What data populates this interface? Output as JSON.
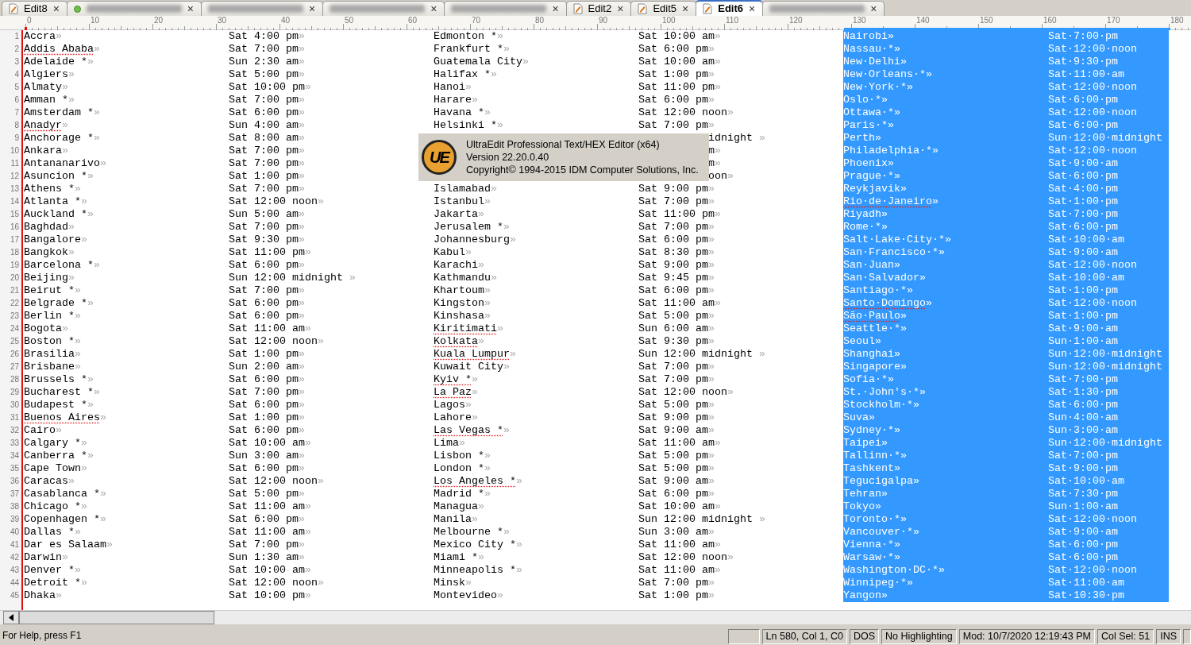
{
  "tabs": [
    {
      "kind": "document",
      "label": "Edit8",
      "close": "×",
      "selected": false
    },
    {
      "kind": "dot-blurred",
      "close": "×",
      "selected": false
    },
    {
      "kind": "blurred",
      "close": "×",
      "selected": false
    },
    {
      "kind": "blurred",
      "close": "×",
      "selected": false
    },
    {
      "kind": "blurred",
      "close": "×",
      "selected": false
    },
    {
      "kind": "document",
      "label": "Edit2",
      "close": "×",
      "selected": false
    },
    {
      "kind": "document",
      "label": "Edit5",
      "close": "×",
      "selected": false
    },
    {
      "kind": "document",
      "label": "Edit6",
      "close": "×",
      "selected": true
    },
    {
      "kind": "blurred",
      "close": "×",
      "selected": false
    }
  ],
  "ruler": [
    "0",
    "10",
    "20",
    "30",
    "40",
    "50",
    "60",
    "70",
    "80",
    "90",
    "100",
    "110",
    "120",
    "130",
    "140",
    "150",
    "160",
    "170",
    "180"
  ],
  "columns": [
    {
      "selected": false
    },
    {
      "selected": false
    },
    {
      "selected": false
    },
    {
      "selected": false
    },
    {
      "selected": true
    },
    {
      "selected": true
    }
  ],
  "lines": [
    {
      "n": "1",
      "cells": [
        "Accra»",
        "Sat 4:00 pm»",
        "Edmonton *»",
        "Sat 10:00 am»",
        "Nairobi»",
        "Sat·7:00·pm"
      ]
    },
    {
      "n": "2",
      "cells": [
        {
          "kind": "misspelled",
          "text": "Addis Ababa»"
        },
        "Sat 7:00 pm»",
        "Frankfurt *»",
        "Sat 6:00 pm»",
        "Nassau·*»",
        "Sat·12:00·noon"
      ]
    },
    {
      "n": "3",
      "cells": [
        "Adelaide *»",
        "Sun 2:30 am»",
        "Guatemala City»",
        "Sat 10:00 am»",
        "New·Delhi»",
        "Sat·9:30·pm"
      ]
    },
    {
      "n": "4",
      "cells": [
        "Algiers»",
        "Sat 5:00 pm»",
        "Halifax *»",
        "Sat 1:00 pm»",
        "New·Orleans·*»",
        "Sat·11:00·am"
      ]
    },
    {
      "n": "5",
      "cells": [
        "Almaty»",
        "Sat 10:00 pm»",
        "Hanoi»",
        "Sat 11:00 pm»",
        "New·York·*»",
        "Sat·12:00·noon"
      ]
    },
    {
      "n": "6",
      "cells": [
        "Amman *»",
        "Sat 7:00 pm»",
        "Harare»",
        "Sat 6:00 pm»",
        "Oslo·*»",
        "Sat·6:00·pm"
      ]
    },
    {
      "n": "7",
      "cells": [
        "Amsterdam *»",
        "Sat 6:00 pm»",
        "Havana *»",
        "Sat 12:00 noon»",
        "Ottawa·*»",
        "Sat·12:00·noon"
      ]
    },
    {
      "n": "8",
      "cells": [
        {
          "kind": "misspelled",
          "text": "Anadyr»"
        },
        "Sun 4:00 am»",
        "Helsinki *»",
        "Sat 7:00 pm»",
        "Paris·*»",
        "Sat·6:00·pm"
      ]
    },
    {
      "n": "9",
      "cells": [
        "Anchorage *»",
        "Sat 8:00 am»",
        {
          "kind": "covered"
        },
        {
          "kind": "tail",
          "text": "idnight »"
        },
        "Perth»",
        "Sun·12:00·midnight"
      ]
    },
    {
      "n": "10",
      "cells": [
        "Ankara»",
        "Sat 7:00 pm»",
        {
          "kind": "covered"
        },
        {
          "kind": "tail",
          "text": "m»"
        },
        "Philadelphia·*»",
        "Sat·12:00·noon"
      ]
    },
    {
      "n": "11",
      "cells": [
        "Antananarivo»",
        "Sat 7:00 pm»",
        {
          "kind": "covered"
        },
        {
          "kind": "tail",
          "text": "m»"
        },
        "Phoenix»",
        "Sat·9:00·am"
      ]
    },
    {
      "n": "12",
      "cells": [
        "Asuncion *»",
        "Sat 1:00 pm»",
        {
          "kind": "covered"
        },
        {
          "kind": "tail",
          "text": "oon»"
        },
        "Prague·*»",
        "Sat·6:00·pm"
      ]
    },
    {
      "n": "13",
      "cells": [
        "Athens *»",
        "Sat 7:00 pm»",
        "Islamabad»",
        "Sat 9:00 pm»",
        "Reykjavik»",
        "Sat·4:00·pm"
      ]
    },
    {
      "n": "14",
      "cells": [
        "Atlanta *»",
        "Sat 12:00 noon»",
        "Istanbul»",
        "Sat 7:00 pm»",
        {
          "kind": "misspelled",
          "text": "Rio·de·Janeiro»"
        },
        "Sat·1:00·pm"
      ]
    },
    {
      "n": "15",
      "cells": [
        "Auckland *»",
        "Sun 5:00 am»",
        "Jakarta»",
        "Sat 11:00 pm»",
        "Riyadh»",
        "Sat·7:00·pm"
      ]
    },
    {
      "n": "16",
      "cells": [
        "Baghdad»",
        "Sat 7:00 pm»",
        "Jerusalem *»",
        "Sat 7:00 pm»",
        "Rome·*»",
        "Sat·6:00·pm"
      ]
    },
    {
      "n": "17",
      "cells": [
        "Bangalore»",
        "Sat 9:30 pm»",
        "Johannesburg»",
        "Sat 6:00 pm»",
        "Salt·Lake·City·*»",
        "Sat·10:00·am"
      ]
    },
    {
      "n": "18",
      "cells": [
        "Bangkok»",
        "Sat 11:00 pm»",
        "Kabul»",
        "Sat 8:30 pm»",
        "San·Francisco·*»",
        "Sat·9:00·am"
      ]
    },
    {
      "n": "19",
      "cells": [
        "Barcelona *»",
        "Sat 6:00 pm»",
        "Karachi»",
        "Sat 9:00 pm»",
        "San·Juan»",
        "Sat·12:00·noon"
      ]
    },
    {
      "n": "20",
      "cells": [
        "Beijing»",
        "Sun 12:00 midnight »",
        "Kathmandu»",
        "Sat 9:45 pm»",
        "San·Salvador»",
        "Sat·10:00·am"
      ]
    },
    {
      "n": "21",
      "cells": [
        "Beirut *»",
        "Sat 7:00 pm»",
        "Khartoum»",
        "Sat 6:00 pm»",
        "Santiago·*»",
        "Sat·1:00·pm"
      ]
    },
    {
      "n": "22",
      "cells": [
        "Belgrade *»",
        "Sat 6:00 pm»",
        "Kingston»",
        "Sat 11:00 am»",
        {
          "kind": "misspelled",
          "text": "Santo·Domingo»"
        },
        "Sat·12:00·noon"
      ]
    },
    {
      "n": "23",
      "cells": [
        "Berlin *»",
        "Sat 6:00 pm»",
        "Kinshasa»",
        "Sat 5:00 pm»",
        {
          "kind": "misspelled",
          "text": "São·Paulo»"
        },
        "Sat·1:00·pm"
      ]
    },
    {
      "n": "24",
      "cells": [
        "Bogota»",
        "Sat 11:00 am»",
        {
          "kind": "misspelled",
          "text": "Kiritimati»"
        },
        "Sun 6:00 am»",
        "Seattle·*»",
        "Sat·9:00·am"
      ]
    },
    {
      "n": "25",
      "cells": [
        "Boston *»",
        "Sat 12:00 noon»",
        {
          "kind": "misspelled",
          "text": "Kolkata»"
        },
        "Sat 9:30 pm»",
        "Seoul»",
        "Sun·1:00·am"
      ]
    },
    {
      "n": "26",
      "cells": [
        "Brasilia»",
        "Sat 1:00 pm»",
        {
          "kind": "misspelled",
          "text": "Kuala Lumpur»"
        },
        "Sun 12:00 midnight »",
        "Shanghai»",
        "Sun·12:00·midnight"
      ]
    },
    {
      "n": "27",
      "cells": [
        "Brisbane»",
        "Sun 2:00 am»",
        "Kuwait City»",
        "Sat 7:00 pm»",
        "Singapore»",
        "Sun·12:00·midnight"
      ]
    },
    {
      "n": "28",
      "cells": [
        "Brussels *»",
        "Sat 6:00 pm»",
        {
          "kind": "misspelled",
          "text": "Kyiv *»"
        },
        "Sat 7:00 pm»",
        "Sofia·*»",
        "Sat·7:00·pm"
      ]
    },
    {
      "n": "29",
      "cells": [
        "Bucharest *»",
        "Sat 7:00 pm»",
        {
          "kind": "misspelled",
          "text": "La Paz»"
        },
        "Sat 12:00 noon»",
        "St.·John's·*»",
        "Sat·1:30·pm"
      ]
    },
    {
      "n": "30",
      "cells": [
        "Budapest *»",
        "Sat 6:00 pm»",
        "Lagos»",
        "Sat 5:00 pm»",
        "Stockholm·*»",
        "Sat·6:00·pm"
      ]
    },
    {
      "n": "31",
      "cells": [
        {
          "kind": "misspelled",
          "text": "Buenos Aires»"
        },
        "Sat 1:00 pm»",
        "Lahore»",
        "Sat 9:00 pm»",
        "Suva»",
        "Sun·4:00·am"
      ]
    },
    {
      "n": "32",
      "cells": [
        "Cairo»",
        "Sat 6:00 pm»",
        {
          "kind": "misspelled",
          "text": "Las Vegas *»"
        },
        "Sat 9:00 am»",
        "Sydney·*»",
        "Sun·3:00·am"
      ]
    },
    {
      "n": "33",
      "cells": [
        "Calgary *»",
        "Sat 10:00 am»",
        "Lima»",
        "Sat 11:00 am»",
        "Taipei»",
        "Sun·12:00·midnight"
      ]
    },
    {
      "n": "34",
      "cells": [
        "Canberra *»",
        "Sun 3:00 am»",
        "Lisbon *»",
        "Sat 5:00 pm»",
        "Tallinn·*»",
        "Sat·7:00·pm"
      ]
    },
    {
      "n": "35",
      "cells": [
        "Cape Town»",
        "Sat 6:00 pm»",
        "London *»",
        "Sat 5:00 pm»",
        "Tashkent»",
        "Sat·9:00·pm"
      ]
    },
    {
      "n": "36",
      "cells": [
        "Caracas»",
        "Sat 12:00 noon»",
        {
          "kind": "misspelled",
          "text": "Los Angeles *»"
        },
        "Sat 9:00 am»",
        "Tegucigalpa»",
        "Sat·10:00·am"
      ]
    },
    {
      "n": "37",
      "cells": [
        "Casablanca *»",
        "Sat 5:00 pm»",
        "Madrid *»",
        "Sat 6:00 pm»",
        "Tehran»",
        "Sat·7:30·pm"
      ]
    },
    {
      "n": "38",
      "cells": [
        "Chicago *»",
        "Sat 11:00 am»",
        "Managua»",
        "Sat 10:00 am»",
        "Tokyo»",
        "Sun·1:00·am"
      ]
    },
    {
      "n": "39",
      "cells": [
        "Copenhagen *»",
        "Sat 6:00 pm»",
        "Manila»",
        "Sun 12:00 midnight »",
        "Toronto·*»",
        "Sat·12:00·noon"
      ]
    },
    {
      "n": "40",
      "cells": [
        "Dallas *»",
        "Sat 11:00 am»",
        "Melbourne *»",
        "Sun 3:00 am»",
        "Vancouver·*»",
        "Sat·9:00·am"
      ]
    },
    {
      "n": "41",
      "cells": [
        "Dar es Salaam»",
        "Sat 7:00 pm»",
        "Mexico City *»",
        "Sat 11:00 am»",
        "Vienna·*»",
        "Sat·6:00·pm"
      ]
    },
    {
      "n": "42",
      "cells": [
        "Darwin»",
        "Sun 1:30 am»",
        "Miami *»",
        "Sat 12:00 noon»",
        "Warsaw·*»",
        "Sat·6:00·pm"
      ]
    },
    {
      "n": "43",
      "cells": [
        "Denver *»",
        "Sat 10:00 am»",
        "Minneapolis *»",
        "Sat 11:00 am»",
        "Washington·DC·*»",
        "Sat·12:00·noon"
      ]
    },
    {
      "n": "44",
      "cells": [
        "Detroit *»",
        "Sat 12:00 noon»",
        "Minsk»",
        "Sat 7:00 pm»",
        "Winnipeg·*»",
        "Sat·11:00·am"
      ]
    },
    {
      "n": "45",
      "cells": [
        "Dhaka»",
        "Sat 10:00 pm»",
        "Montevideo»",
        "Sat 1:00 pm»",
        "Yangon»",
        "Sat·10:30·pm"
      ]
    }
  ],
  "splash": {
    "logo": "UE",
    "lines": [
      "UltraEdit Professional Text/HEX Editor (x64)",
      "Version 22.20.0.40",
      "Copyright© 1994-2015 IDM Computer Solutions, Inc."
    ]
  },
  "status_bar": {
    "help": "For Help, press F1",
    "panels": [
      "Ln 580, Col 1, C0",
      "DOS",
      "No Highlighting",
      "Mod: 10/7/2020 12:19:43 PM",
      "Col Sel: 51",
      "INS"
    ]
  }
}
